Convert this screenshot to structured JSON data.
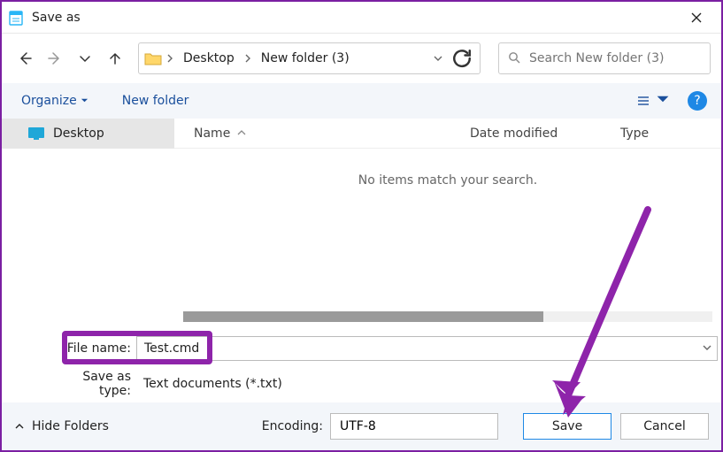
{
  "window": {
    "title": "Save as"
  },
  "breadcrumb": {
    "items": [
      "Desktop",
      "New folder (3)"
    ]
  },
  "search": {
    "placeholder": "Search New folder (3)"
  },
  "toolbar": {
    "organize": "Organize",
    "new_folder": "New folder"
  },
  "sidebar": {
    "items": [
      {
        "label": "Desktop"
      }
    ]
  },
  "columns": {
    "name": "Name",
    "date_modified": "Date modified",
    "type": "Type"
  },
  "content": {
    "empty_message": "No items match your search."
  },
  "fields": {
    "file_name_label": "File name:",
    "file_name_value": "Test.cmd",
    "save_as_type_label": "Save as type:",
    "save_as_type_value": "Text documents (*.txt)"
  },
  "bottom": {
    "hide_folders": "Hide Folders",
    "encoding_label": "Encoding:",
    "encoding_value": "UTF-8",
    "save": "Save",
    "cancel": "Cancel"
  },
  "annotation": {
    "highlight_color": "#8e24aa",
    "arrow_color": "#8e24aa"
  }
}
